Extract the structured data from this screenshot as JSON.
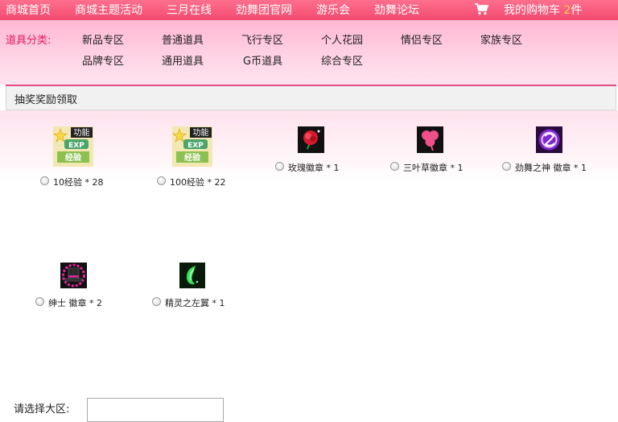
{
  "nav": {
    "items": [
      "商城首页",
      "商城主题活动",
      "三月在线",
      "劲舞团官网",
      "游乐会",
      "劲舞论坛"
    ],
    "cart_prefix": "我的购物车",
    "cart_count": "2",
    "cart_suffix": "件",
    "cart_icon": "shopping-cart-icon"
  },
  "categories": {
    "label": "道具分类:",
    "row1": [
      "新品专区",
      "普通道具",
      "飞行专区",
      "个人花园",
      "情侣专区",
      "家族专区"
    ],
    "row2": [
      "品牌专区",
      "通用道具",
      "G币道具",
      "综合专区"
    ]
  },
  "panel": {
    "title": "抽奖奖励领取"
  },
  "prizes": [
    {
      "label": "10经验 * 28",
      "icon": "exp-card-icon",
      "badge": "功能",
      "card_text": "EXP",
      "card_sub": "经验"
    },
    {
      "label": "100经验 * 22",
      "icon": "exp-card-icon",
      "badge": "功能",
      "card_text": "EXP",
      "card_sub": "经验"
    },
    {
      "label": "玫瑰徽章 * 1",
      "icon": "rose-badge-icon"
    },
    {
      "label": "三叶草徽章 * 1",
      "icon": "clover-badge-icon"
    },
    {
      "label": "劲舞之神 徽章 * 1",
      "icon": "dance-god-badge-icon"
    },
    {
      "label": "绅士 徽章 * 2",
      "icon": "gentleman-hat-badge-icon"
    },
    {
      "label": "精灵之左翼 * 1",
      "icon": "elf-left-wing-icon"
    }
  ],
  "region": {
    "label": "请选择大区:",
    "value": ""
  },
  "colors": {
    "nav_bg": "#f24b6f",
    "accent": "#e3185d",
    "cart_count": "#ffd24a"
  }
}
